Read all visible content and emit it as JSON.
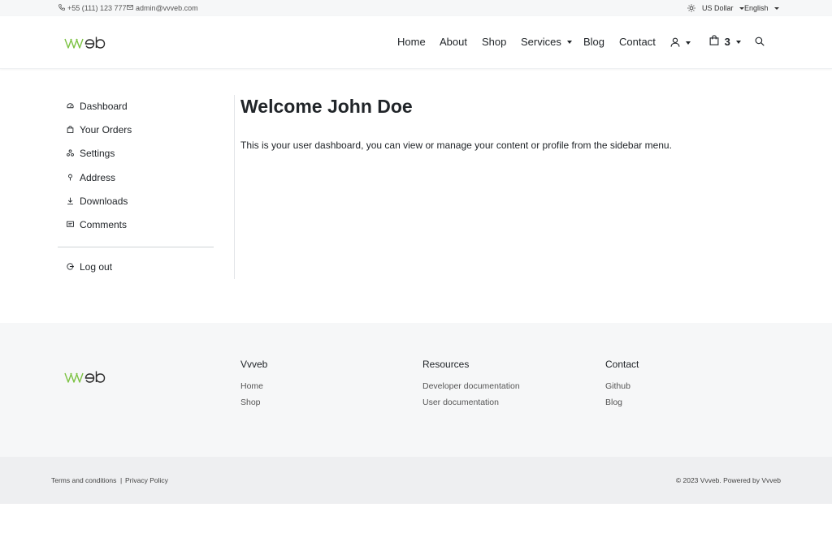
{
  "topbar": {
    "phone": "+55 (111) 123 777",
    "email": "admin@vvveb.com",
    "currency": "US Dollar",
    "language": "English"
  },
  "logo": {
    "text": "vvveb"
  },
  "nav": {
    "home": "Home",
    "about": "About",
    "shop": "Shop",
    "services": "Services",
    "blog": "Blog",
    "contact": "Contact",
    "cart_count": "3"
  },
  "sidebar": {
    "items": [
      {
        "label": "Dashboard",
        "icon": "dashboard-icon"
      },
      {
        "label": "Your Orders",
        "icon": "bag-icon"
      },
      {
        "label": "Settings",
        "icon": "settings-icon"
      },
      {
        "label": "Address",
        "icon": "pin-icon"
      },
      {
        "label": "Downloads",
        "icon": "download-icon"
      },
      {
        "label": "Comments",
        "icon": "comment-icon"
      }
    ],
    "logout": "Log out"
  },
  "main": {
    "title": "Welcome John Doe",
    "text": "This is your user dashboard, you can view or manage your content or profile from the sidebar menu."
  },
  "footer": {
    "col1": {
      "title": "Vvveb",
      "links": [
        "Home",
        "Shop"
      ]
    },
    "col2": {
      "title": "Resources",
      "links": [
        "Developer documentation",
        "User documentation"
      ]
    },
    "col3": {
      "title": "Contact",
      "links": [
        "Github",
        "Blog"
      ]
    }
  },
  "bottom": {
    "terms": "Terms and conditions",
    "separator": "|",
    "privacy": "Privacy Policy",
    "copyright": "© 2023 Vvveb. Powered by Vvveb"
  },
  "colors": {
    "logo_green": "#7cc242",
    "logo_dark": "#2b2b2b"
  }
}
